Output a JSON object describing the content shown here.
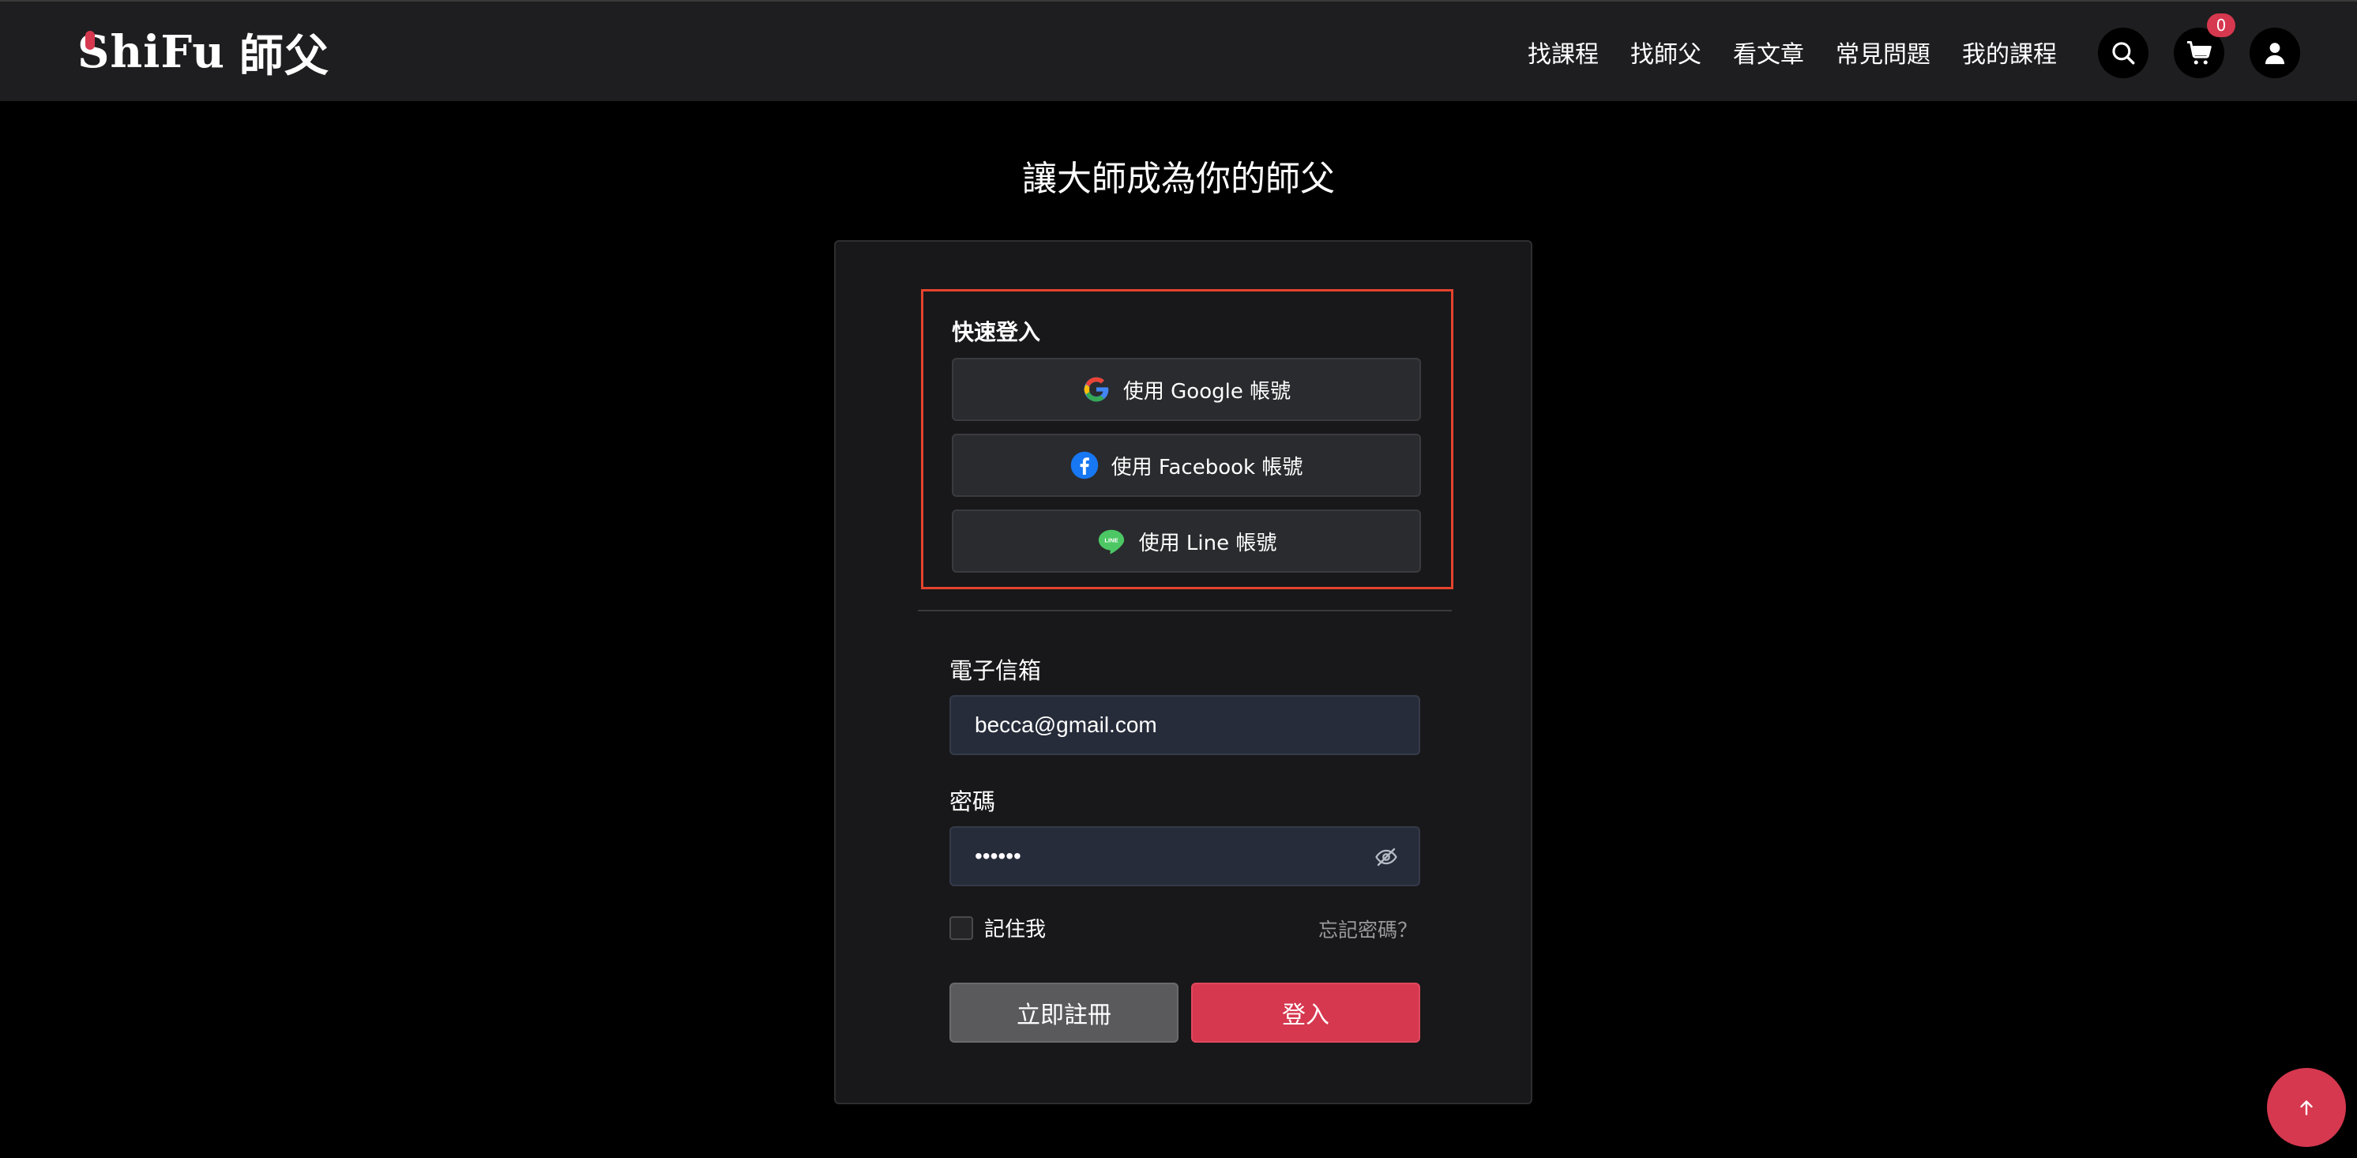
{
  "header": {
    "logo_en": "ShiFu",
    "logo_zh": "師父",
    "nav": [
      "找課程",
      "找師父",
      "看文章",
      "常見問題",
      "我的課程"
    ],
    "cart_count": "0"
  },
  "main": {
    "title": "讓大師成為你的師父"
  },
  "quick_login": {
    "title": "快速登入",
    "google": "使用 Google 帳號",
    "facebook": "使用 Facebook 帳號",
    "line": "使用 Line 帳號",
    "line_icon_text": "LINE"
  },
  "form": {
    "email_label": "電子信箱",
    "email_value": "becca@gmail.com",
    "password_label": "密碼",
    "password_value": "••••••",
    "remember_label": "記住我",
    "forgot_label": "忘記密碼？",
    "register_label": "立即註冊",
    "login_label": "登入"
  },
  "colors": {
    "accent": "#d6384f",
    "highlight_border": "#e5432d",
    "topbar": "#1e1e20",
    "card": "#18181a"
  },
  "icons": [
    "search-icon",
    "cart-icon",
    "user-icon",
    "google-icon",
    "facebook-icon",
    "line-icon",
    "eye-slash-icon",
    "arrow-up-icon"
  ]
}
